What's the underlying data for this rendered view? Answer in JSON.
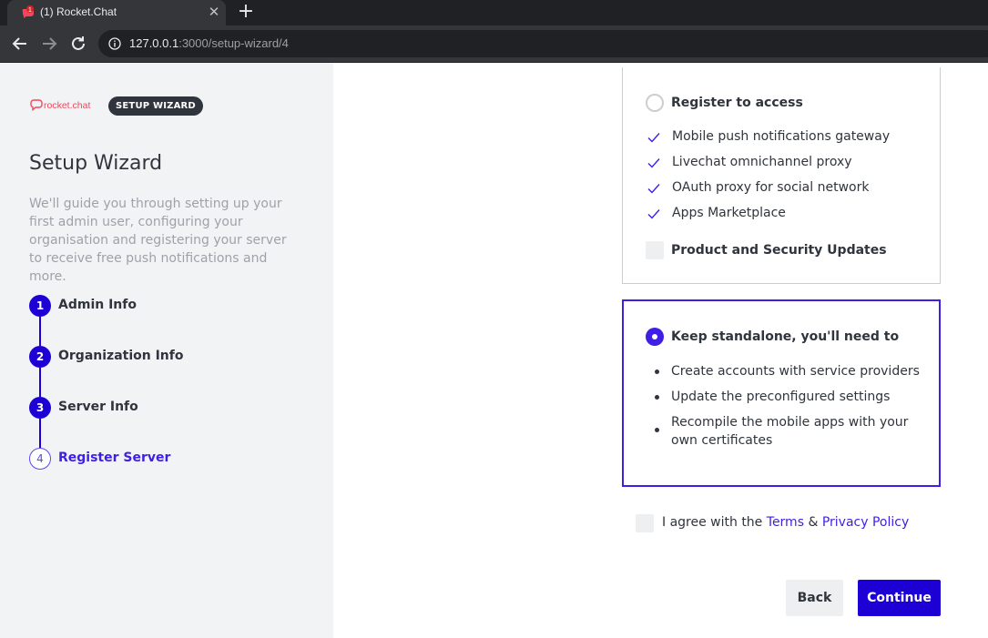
{
  "browser": {
    "tab_title": "(1) Rocket.Chat",
    "tab_badge": "1",
    "url_host": "127.0.0.1",
    "url_path": ":3000/setup-wizard/4"
  },
  "sidebar": {
    "logo_text": "rocket.chat",
    "badge": "SETUP WIZARD",
    "title": "Setup Wizard",
    "description": "We'll guide you through setting up your first admin user, configuring your organisation and registering your server to receive free push notifications and more.",
    "steps": [
      {
        "number": "1",
        "label": "Admin Info",
        "state": "done"
      },
      {
        "number": "2",
        "label": "Organization Info",
        "state": "done"
      },
      {
        "number": "3",
        "label": "Server Info",
        "state": "done"
      },
      {
        "number": "4",
        "label": "Register Server",
        "state": "current"
      }
    ]
  },
  "main": {
    "register_option": {
      "title": "Register to access",
      "selected": false,
      "features": [
        "Mobile push notifications gateway",
        "Livechat omnichannel proxy",
        "OAuth proxy for social network",
        "Apps Marketplace"
      ],
      "updates_label": "Product and Security Updates",
      "updates_checked": false
    },
    "standalone_option": {
      "title": "Keep standalone, you'll need to",
      "selected": true,
      "items": [
        "Create accounts with service providers",
        "Update the preconfigured settings",
        "Recompile the mobile apps with your own certificates"
      ]
    },
    "agree": {
      "prefix": "I agree with the",
      "terms": "Terms",
      "amp": "&",
      "privacy": "Privacy Policy",
      "checked": false
    },
    "buttons": {
      "back": "Back",
      "continue": "Continue"
    }
  },
  "colors": {
    "accent": "#1d00d4",
    "accent_light": "#3f1fe6",
    "brand_red": "#f5455c"
  }
}
